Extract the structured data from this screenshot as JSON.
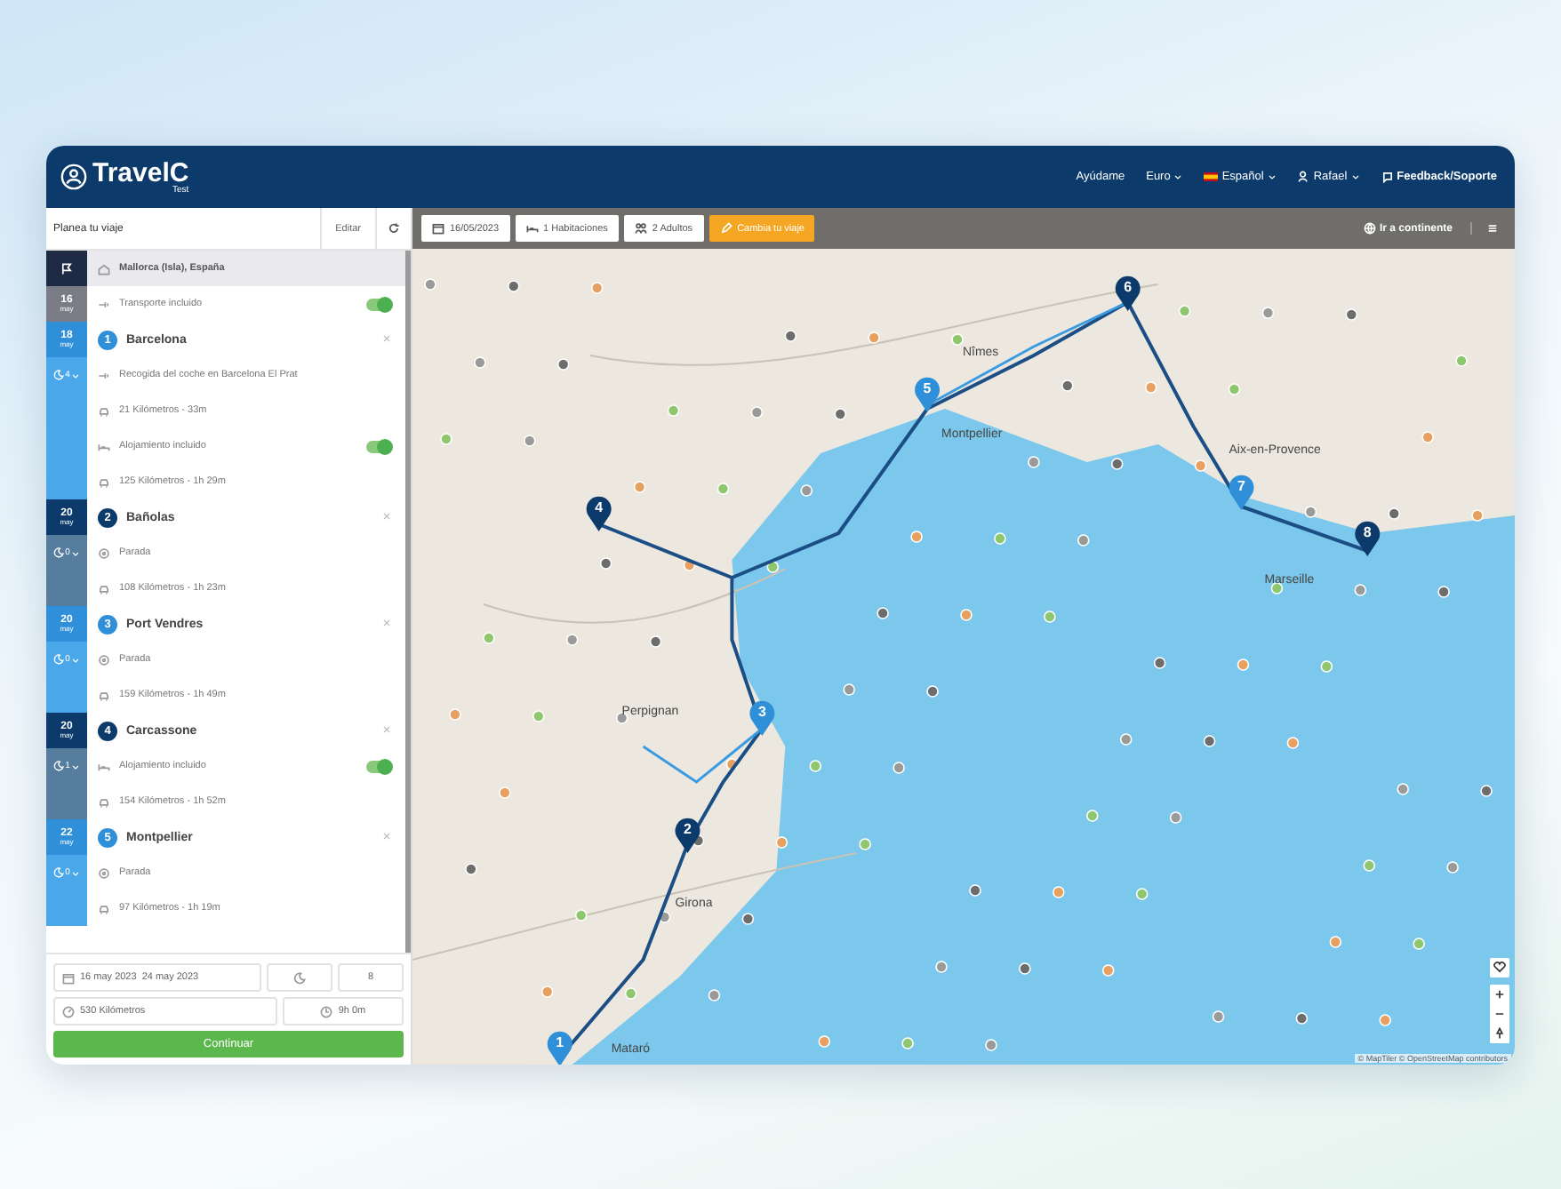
{
  "header": {
    "logo": "TravelC",
    "logo_sub": "Test",
    "nav": [
      {
        "kind": "link",
        "label": "Ayúdame"
      },
      {
        "kind": "dropdown",
        "label": "Euro"
      },
      {
        "kind": "flag",
        "label": "Español"
      },
      {
        "kind": "user",
        "label": "Rafael"
      },
      {
        "kind": "feedback",
        "label": "Feedback/Soporte"
      }
    ]
  },
  "sidebar": {
    "title": "Planea tu viaje",
    "edit": "Editar",
    "origin": {
      "day": "16",
      "month": "may",
      "name": "Mallorca (Isla), España"
    },
    "transport": {
      "label": "Transporte incluido",
      "on": true
    },
    "stops": [
      {
        "number": "1",
        "name": "Barcelona",
        "day": "18",
        "month": "may",
        "color": "#2f8fd8",
        "nights": "4",
        "rows": [
          {
            "kind": "pickup",
            "text": "Recogida del coche en Barcelona El Prat"
          },
          {
            "kind": "drive",
            "text": "21 Kilómetros - 33m"
          },
          {
            "kind": "lodging",
            "text": "Alojamiento incluido",
            "on": true
          },
          {
            "kind": "drive",
            "text": "125 Kilómetros - 1h 29m"
          }
        ]
      },
      {
        "number": "2",
        "name": "Bañolas",
        "day": "20",
        "month": "may",
        "color": "#0b3a6b",
        "nights": "0",
        "rows": [
          {
            "kind": "stop",
            "text": "Parada"
          },
          {
            "kind": "drive",
            "text": "108 Kilómetros - 1h 23m"
          }
        ]
      },
      {
        "number": "3",
        "name": "Port Vendres",
        "day": "20",
        "month": "may",
        "color": "#2f8fd8",
        "nights": "0",
        "rows": [
          {
            "kind": "stop",
            "text": "Parada"
          },
          {
            "kind": "drive",
            "text": "159 Kilómetros - 1h 49m"
          }
        ]
      },
      {
        "number": "4",
        "name": "Carcassone",
        "day": "20",
        "month": "may",
        "color": "#0b3a6b",
        "nights": "1",
        "rows": [
          {
            "kind": "lodging",
            "text": "Alojamiento incluido",
            "on": true
          },
          {
            "kind": "drive",
            "text": "154 Kilómetros - 1h 52m"
          }
        ]
      },
      {
        "number": "5",
        "name": "Montpellier",
        "day": "22",
        "month": "may",
        "color": "#2f8fd8",
        "nights": "0",
        "rows": [
          {
            "kind": "stop",
            "text": "Parada"
          },
          {
            "kind": "drive",
            "text": "97 Kilómetros - 1h 19m"
          }
        ]
      }
    ],
    "summary": {
      "start": "16 may 2023",
      "end": "24 may 2023",
      "nights": "8",
      "distance": "530 Kilómetros",
      "duration": "9h 0m",
      "button": "Continuar"
    }
  },
  "toolbar": {
    "date": "16/05/2023",
    "rooms": "1 Habitaciones",
    "adults": "2 Adultos",
    "change": "Cambia tu viaje",
    "continent": "Ir a continente"
  },
  "map": {
    "markers": [
      {
        "number": "1",
        "color": "#2f8fd8"
      },
      {
        "number": "2",
        "color": "#0b3a6b"
      },
      {
        "number": "3",
        "color": "#2f8fd8"
      },
      {
        "number": "4",
        "color": "#0b3a6b"
      },
      {
        "number": "5",
        "color": "#2f8fd8"
      },
      {
        "number": "6",
        "color": "#0b3a6b"
      },
      {
        "number": "7",
        "color": "#2f8fd8"
      },
      {
        "number": "8",
        "color": "#0b3a6b"
      }
    ],
    "labels": [
      "Nîmes",
      "Montpellier",
      "Aix-en-Provence",
      "Marseille",
      "Perpignan",
      "Girona",
      "Mataró"
    ],
    "attribution": "© MapTiler © OpenStreetMap contributors"
  }
}
